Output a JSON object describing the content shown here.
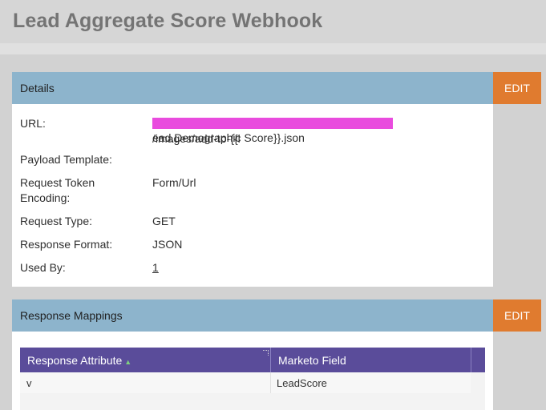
{
  "page": {
    "title": "Lead Aggregate Score Webhook"
  },
  "details": {
    "header": "Details",
    "edit_label": "EDIT",
    "fields": {
      "url_label": "URL:",
      "url_value_suffix": "/images/add-to-{{l",
      "url_value_line2": "ead.Demographic Score}}.json",
      "payload_label": "Payload Template:",
      "payload_value": "",
      "encoding_label_1": "Request Token",
      "encoding_label_2": "Encoding:",
      "encoding_value": "Form/Url",
      "request_type_label": "Request Type:",
      "request_type_value": "GET",
      "response_format_label": "Response Format:",
      "response_format_value": "JSON",
      "used_by_label": "Used By:",
      "used_by_value": "1"
    }
  },
  "mappings": {
    "header": "Response Mappings",
    "edit_label": "EDIT",
    "columns": [
      "Response Attribute",
      "Marketo Field"
    ],
    "rows": [
      {
        "attribute": "v",
        "field": "LeadScore"
      }
    ]
  },
  "colors": {
    "header_blue": "#8db4cc",
    "edit_orange": "#e07b2f",
    "grid_header_purple": "#5a4c9a",
    "redaction_magenta": "#e94bde"
  }
}
